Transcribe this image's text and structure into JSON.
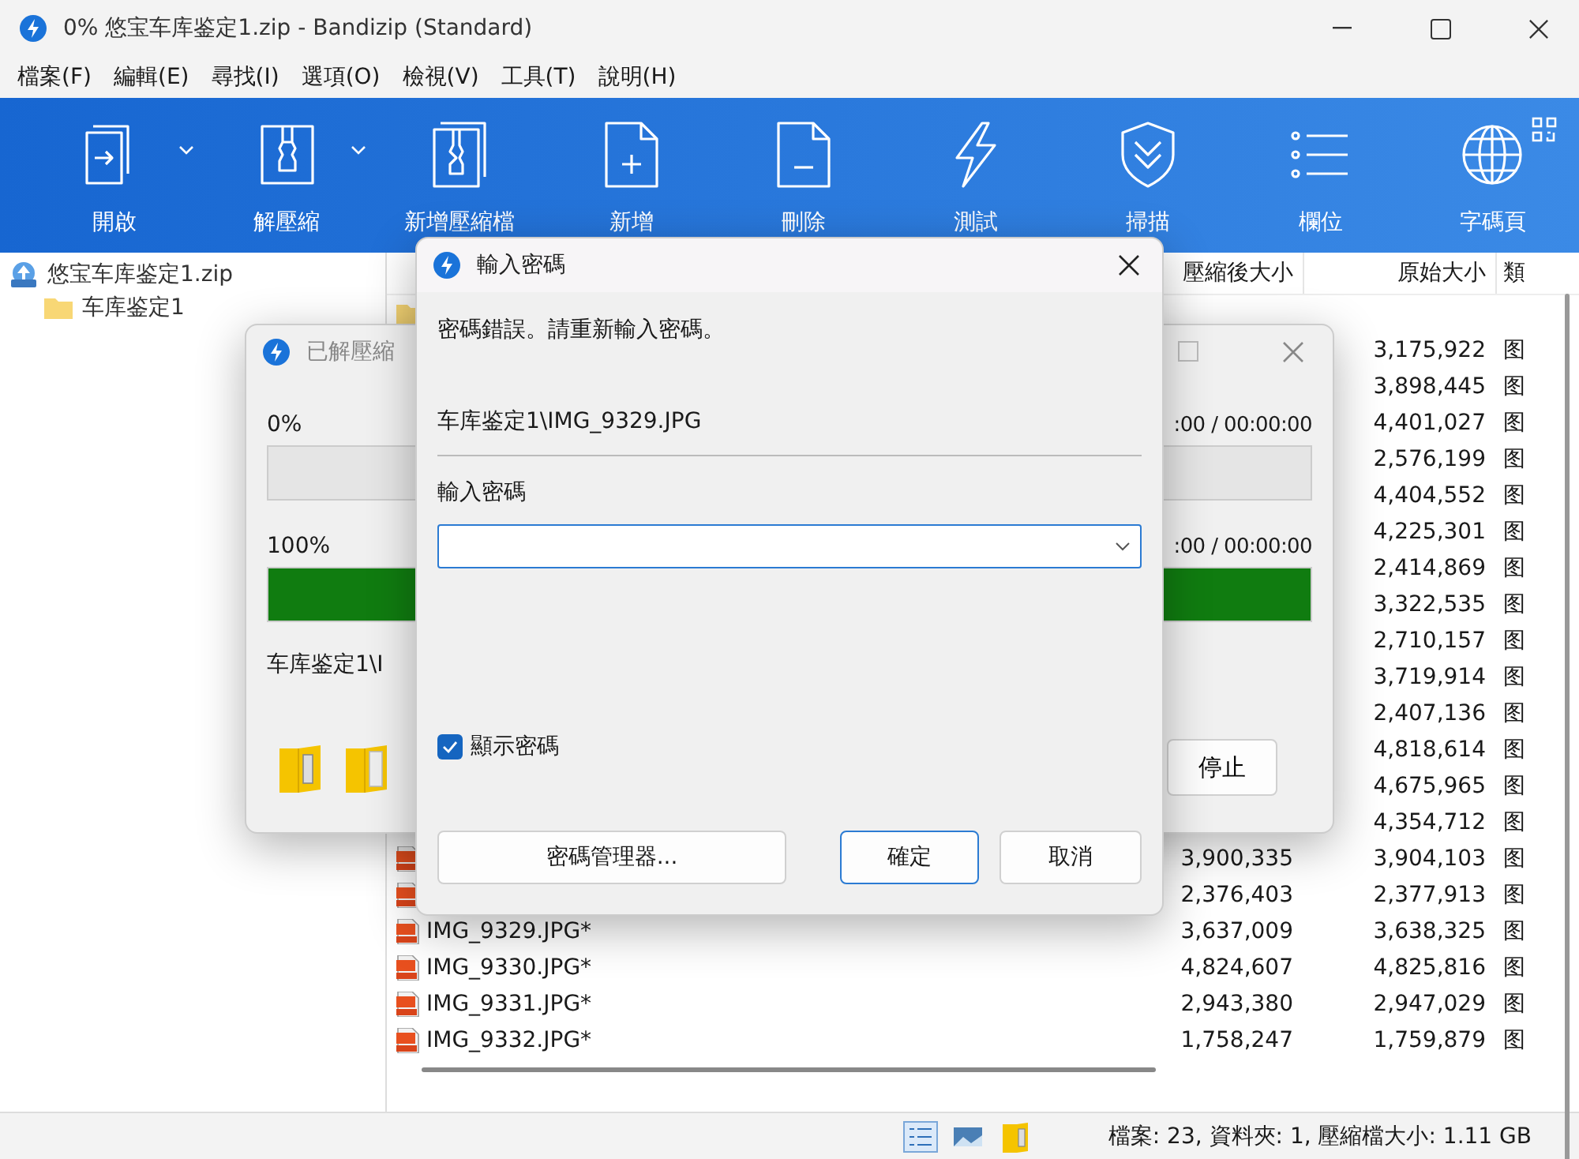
{
  "window": {
    "title": "0% 悠宝车库鉴定1.zip - Bandizip (Standard)"
  },
  "menu": [
    "檔案(F)",
    "編輯(E)",
    "尋找(I)",
    "選項(O)",
    "檢視(V)",
    "工具(T)",
    "說明(H)"
  ],
  "toolbar": [
    {
      "label": "開啟",
      "kind": "open",
      "dropdown": true
    },
    {
      "label": "解壓縮",
      "kind": "extract",
      "dropdown": true
    },
    {
      "label": "新增壓縮檔",
      "kind": "archive",
      "dropdown": false
    },
    {
      "label": "新增",
      "kind": "add",
      "dropdown": false
    },
    {
      "label": "刪除",
      "kind": "delete",
      "dropdown": false
    },
    {
      "label": "測試",
      "kind": "test",
      "dropdown": false
    },
    {
      "label": "掃描",
      "kind": "scan",
      "dropdown": false
    },
    {
      "label": "欄位",
      "kind": "columns",
      "dropdown": false
    },
    {
      "label": "字碼頁",
      "kind": "codepage",
      "dropdown": false
    }
  ],
  "tree": [
    {
      "label": "悠宝车库鉴定1.zip",
      "kind": "zip",
      "children": [
        {
          "label": "车库鉴定1",
          "kind": "folder"
        }
      ]
    }
  ],
  "file_list": {
    "columns": [
      "壓縮後大小",
      "原始大小",
      "類"
    ],
    "rows": [
      {
        "kind": "folder"
      },
      {
        "original": "3,175,922",
        "type": "图"
      },
      {
        "original": "3,898,445",
        "type": "图"
      },
      {
        "original": "4,401,027",
        "type": "图"
      },
      {
        "original": "2,576,199",
        "type": "图"
      },
      {
        "original": "4,404,552",
        "type": "图"
      },
      {
        "original": "4,225,301",
        "type": "图"
      },
      {
        "original": "2,414,869",
        "type": "图"
      },
      {
        "original": "3,322,535",
        "type": "图"
      },
      {
        "original": "2,710,157",
        "type": "图"
      },
      {
        "original": "3,719,914",
        "type": "图"
      },
      {
        "original": "2,407,136",
        "type": "图"
      },
      {
        "original": "4,818,614",
        "type": "图"
      },
      {
        "original": "4,675,965",
        "type": "图"
      },
      {
        "original": "4,354,712",
        "type": "图"
      },
      {
        "kind": "jpg",
        "packed": "3,900,335",
        "original": "3,904,103",
        "type": "图"
      },
      {
        "kind": "jpg",
        "packed": "2,376,403",
        "original": "2,377,913",
        "type": "图"
      },
      {
        "kind": "jpg",
        "name": "IMG_9329.JPG*",
        "packed": "3,637,009",
        "original": "3,638,325",
        "type": "图"
      },
      {
        "kind": "jpg",
        "name": "IMG_9330.JPG*",
        "packed": "4,824,607",
        "original": "4,825,816",
        "type": "图"
      },
      {
        "kind": "jpg",
        "name": "IMG_9331.JPG*",
        "packed": "2,943,380",
        "original": "2,947,029",
        "type": "图"
      },
      {
        "kind": "jpg",
        "name": "IMG_9332.JPG*",
        "packed": "1,758,247",
        "original": "1,759,879",
        "type": "图"
      }
    ]
  },
  "status_bar": {
    "text": "檔案: 23, 資料夾: 1, 壓縮檔大小: 1.11 GB"
  },
  "progress_dialog": {
    "title": "已解壓縮",
    "bars": [
      {
        "percent": "0%",
        "time": ":00 / 00:00:00",
        "level": 0
      },
      {
        "percent": "100%",
        "time": ":00 / 00:00:00",
        "level": 1
      }
    ],
    "current_file": "车库鉴定1\\I",
    "stop_button": "停止"
  },
  "password_dialog": {
    "title": "輸入密碼",
    "message": "密碼錯誤。請重新輸入密碼。",
    "file": "车库鉴定1\\IMG_9329.JPG",
    "label": "輸入密碼",
    "show_password": {
      "label": "顯示密碼",
      "checked": true
    },
    "buttons": [
      {
        "label": "密碼管理器...",
        "kind": "manager"
      },
      {
        "label": "確定",
        "kind": "default"
      },
      {
        "label": "取消",
        "kind": "cancel"
      }
    ]
  }
}
